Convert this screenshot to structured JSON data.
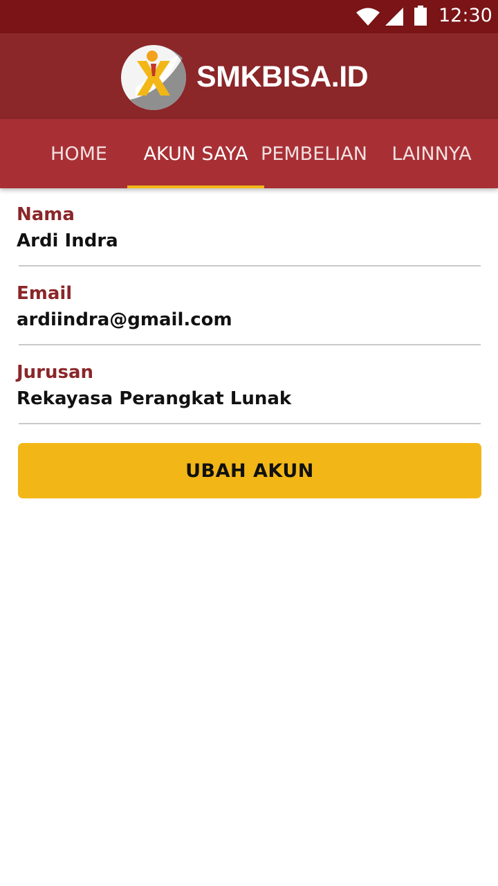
{
  "status_bar": {
    "time": "12:30",
    "icons": [
      "wifi-icon",
      "cell-signal-icon",
      "battery-icon"
    ]
  },
  "header": {
    "logo_text": "SMKBISA.ID",
    "background": "#8b2629"
  },
  "tabs": [
    {
      "label": "HOME",
      "active": false
    },
    {
      "label": "AKUN SAYA",
      "active": true
    },
    {
      "label": "PEMBELIAN",
      "active": false
    },
    {
      "label": "LAINNYA",
      "active": false
    }
  ],
  "profile": {
    "name_label": "Nama",
    "name_value": "Ardi Indra",
    "email_label": "Email",
    "email_value": "ardiindra@gmail.com",
    "major_label": "Jurusan",
    "major_value": "Rekayasa Perangkat Lunak"
  },
  "actions": {
    "edit_account_label": "UBAH AKUN"
  },
  "colors": {
    "status_bar": "#7a1416",
    "tab_bar": "#a83035",
    "accent": "#f2b717",
    "label": "#8b2629"
  }
}
